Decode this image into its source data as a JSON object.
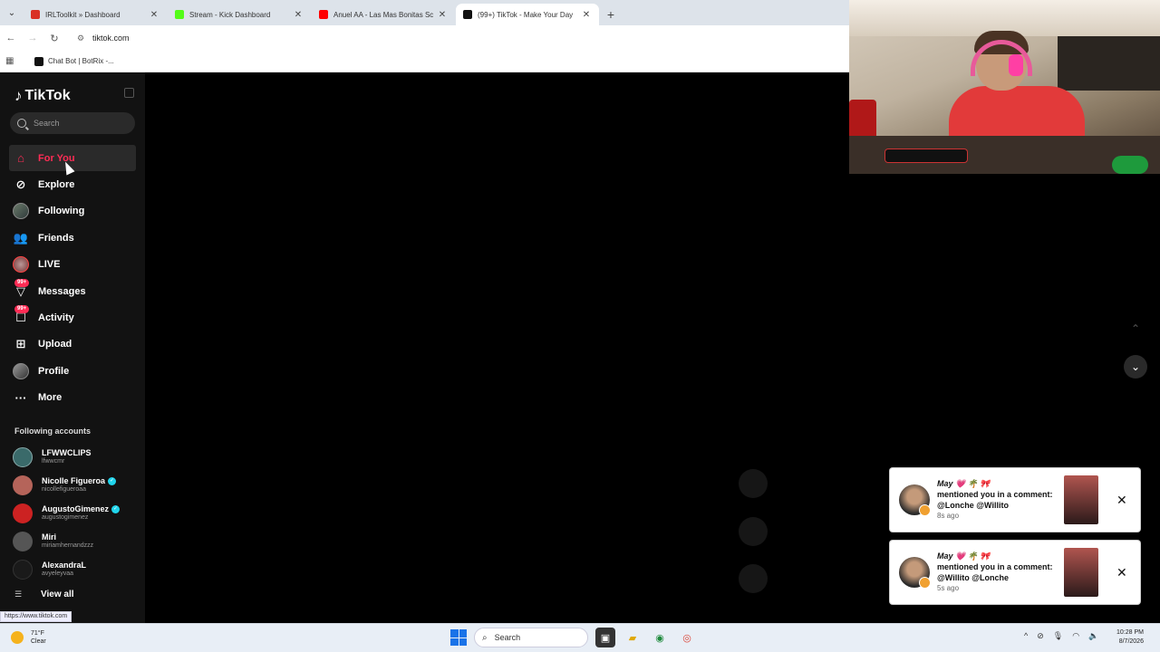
{
  "browser": {
    "tabs": [
      {
        "title": "IRLToolkit » Dashboard",
        "color": "#d93025",
        "active": false
      },
      {
        "title": "Stream - Kick Dashboard",
        "color": "#53fc18",
        "active": false
      },
      {
        "title": "Anuel AA - Las Mas Bonitas Sc",
        "color": "#ff0000",
        "active": false
      },
      {
        "title": "(99+) TikTok - Make Your Day",
        "color": "#111111",
        "active": true
      }
    ],
    "address": "tiktok.com",
    "bookmark": "Chat Bot | BotRix -..."
  },
  "tiktok": {
    "logo": "TikTok",
    "search_placeholder": "Search",
    "nav": [
      {
        "label": "For You",
        "icon": "home-icon",
        "active": true
      },
      {
        "label": "Explore",
        "icon": "compass-icon"
      },
      {
        "label": "Following",
        "icon": "following-avatar-icon"
      },
      {
        "label": "Friends",
        "icon": "friends-icon"
      },
      {
        "label": "LIVE",
        "icon": "live-icon"
      },
      {
        "label": "Messages",
        "icon": "messages-icon",
        "badge": "99+"
      },
      {
        "label": "Activity",
        "icon": "activity-icon",
        "badge": "99+"
      },
      {
        "label": "Upload",
        "icon": "upload-icon"
      },
      {
        "label": "Profile",
        "icon": "profile-icon"
      },
      {
        "label": "More",
        "icon": "more-icon"
      }
    ],
    "following_title": "Following accounts",
    "accounts": [
      {
        "name": "LFWWCLIPS",
        "handle": "lfwwcmr",
        "verified": false,
        "color": "#3a6a6a"
      },
      {
        "name": "Nicolle Figueroa",
        "handle": "nicollefigueroaa",
        "verified": true,
        "color": "#b5645a"
      },
      {
        "name": "AugustoGimenez",
        "handle": "augustogimenez",
        "verified": true,
        "color": "#c22"
      },
      {
        "name": "Miri",
        "handle": "miriamhernandzzz",
        "verified": false,
        "color": "#555"
      },
      {
        "name": "AlexandraL",
        "handle": "avyeleyvaa",
        "verified": false,
        "color": "#111"
      }
    ],
    "view_all": "View all",
    "status_url": "https://www.tiktok.com"
  },
  "notifications": [
    {
      "who": "May 💗 🌴 🎀",
      "message": "mentioned you in a comment: @Lonche @Willito",
      "ago": "8s ago"
    },
    {
      "who": "May 💗 🌴 🎀",
      "message": "mentioned you in a comment: @Willito @Lonche",
      "ago": "5s ago"
    }
  ],
  "taskbar": {
    "weather_temp": "71°F",
    "weather_desc": "Clear",
    "search": "Search",
    "time": "10:28 PM",
    "date": "8/7/2026"
  }
}
